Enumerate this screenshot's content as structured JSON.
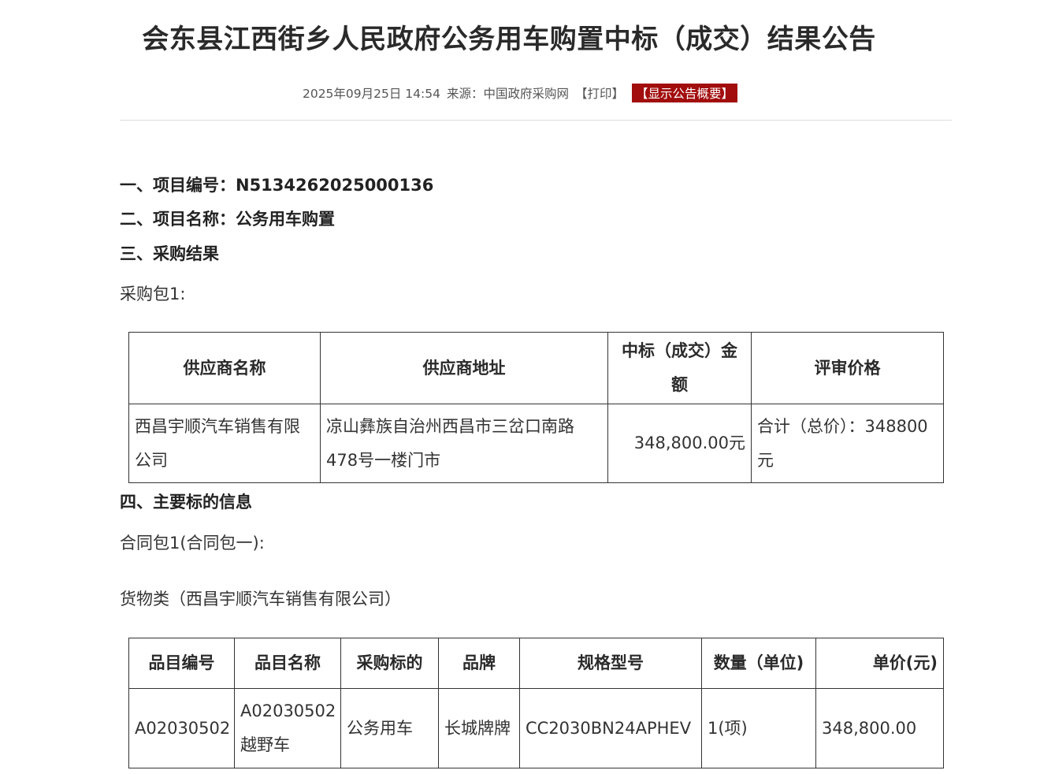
{
  "title": "会东县江西街乡人民政府公务用车购置中标（成交）结果公告",
  "meta": {
    "datetime": "2025年09月25日 14:54",
    "source_label": "来源：",
    "source": "中国政府采购网",
    "print": "【打印】",
    "summary": "【显示公告概要】"
  },
  "sections": {
    "project_no": "一、项目编号：N5134262025000136",
    "project_name": "二、项目名称：公务用车购置",
    "result": "三、采购结果",
    "package": "采购包1:",
    "main_info": "四、主要标的信息",
    "contract": "合同包1(合同包一):",
    "goods": "货物类（西昌宇顺汽车销售有限公司）"
  },
  "result_table": {
    "headers": [
      "供应商名称",
      "供应商地址",
      "中标（成交）金额",
      "评审价格"
    ],
    "row": {
      "supplier": "西昌宇顺汽车销售有限公司",
      "address": "凉山彝族自治州西昌市三岔口南路478号一楼门市",
      "amount": "348,800.00元",
      "price": "合计（总价）：348800元"
    }
  },
  "goods_table": {
    "headers": [
      "品目编号",
      "品目名称",
      "采购标的",
      "品牌",
      "规格型号",
      "数量（单位)",
      "单价(元)"
    ],
    "row": {
      "code": "A02030502",
      "name": "A02030502越野车",
      "target": "公务用车",
      "brand": "长城牌牌",
      "model": "CC2030BN24APHEV",
      "qty": "1(项)",
      "price": "348,800.00"
    }
  }
}
